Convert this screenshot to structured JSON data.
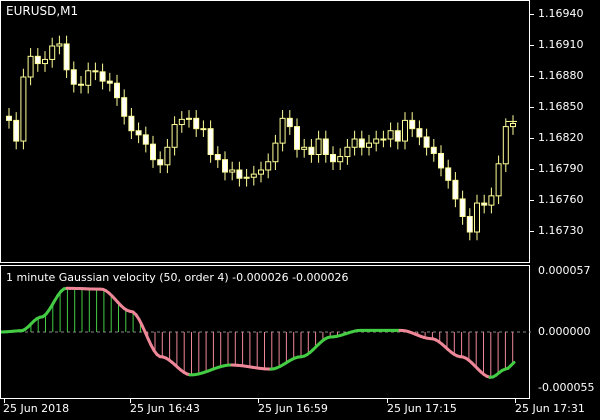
{
  "chart": {
    "symbol": "EURUSD,M1",
    "bull_color": "#000000",
    "bear_color": "#ffffff",
    "candle_outline": "#ffff99",
    "price_levels": [
      "1.16940",
      "1.16910",
      "1.16880",
      "1.16850",
      "1.16820",
      "1.16790",
      "1.16760",
      "1.16730"
    ],
    "current_price": "1.16837"
  },
  "indicator": {
    "label": "1 minute Gaussian velocity (50, order 4) -0.000026 -0.000026",
    "levels": [
      "0.000057",
      "0.000000",
      "-0.000055"
    ],
    "up_color": "#44cc44",
    "down_color": "#ee8899",
    "zero_line_color": "#888888"
  },
  "time_axis": {
    "labels": [
      "25 Jun 2018",
      "25 Jun 16:43",
      "25 Jun 16:59",
      "25 Jun 17:15",
      "25 Jun 17:31"
    ]
  }
}
